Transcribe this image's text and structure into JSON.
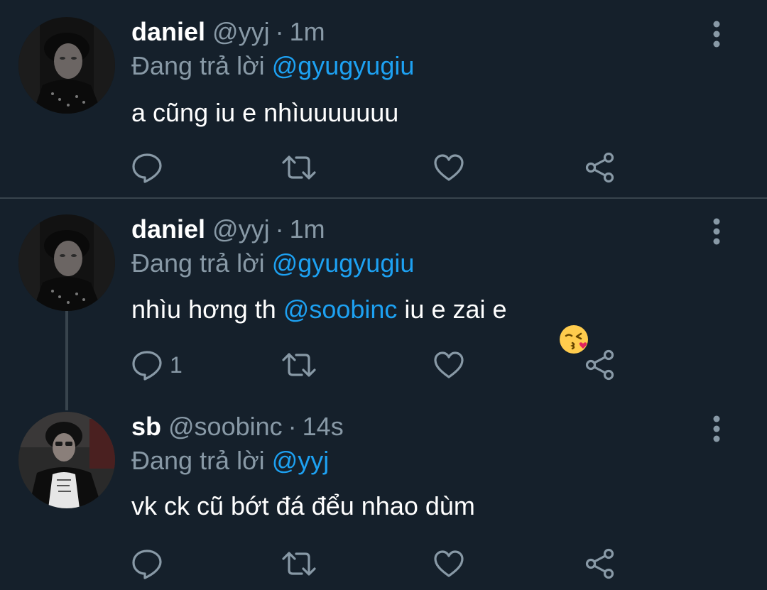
{
  "colors": {
    "background": "#15202b",
    "muted": "#8899a6",
    "mention": "#1da1f2",
    "divider": "#38444d"
  },
  "tweets": [
    {
      "name": "daniel",
      "handle": "@yyj",
      "separator": "·",
      "time": "1m",
      "reply_prefix": "Đang trả lời ",
      "reply_to": "@gyugyugiu",
      "text": "a cũng iu e nhìuuuuuuu",
      "reply_count": "",
      "avatar_icon": "profile-photo"
    },
    {
      "name": "daniel",
      "handle": "@yyj",
      "separator": "·",
      "time": "1m",
      "reply_prefix": "Đang trả lời ",
      "reply_to": "@gyugyugiu",
      "text_before": "nhìu hơng th ",
      "text_mention": "@soobinc",
      "text_after": " iu e zai e",
      "emoji": "face-blowing-kiss-emoji",
      "reply_count": "1",
      "avatar_icon": "profile-photo"
    },
    {
      "name": "sb",
      "handle": "@soobinc",
      "separator": "·",
      "time": "14s",
      "reply_prefix": "Đang trả lời ",
      "reply_to": "@yyj",
      "text": "vk ck cũ bớt đá đểu nhao dùm",
      "reply_count": "",
      "avatar_icon": "profile-photo"
    }
  ],
  "icons": {
    "reply": "reply-icon",
    "retweet": "retweet-icon",
    "like": "like-icon",
    "share": "share-icon",
    "more": "more-options-icon"
  }
}
